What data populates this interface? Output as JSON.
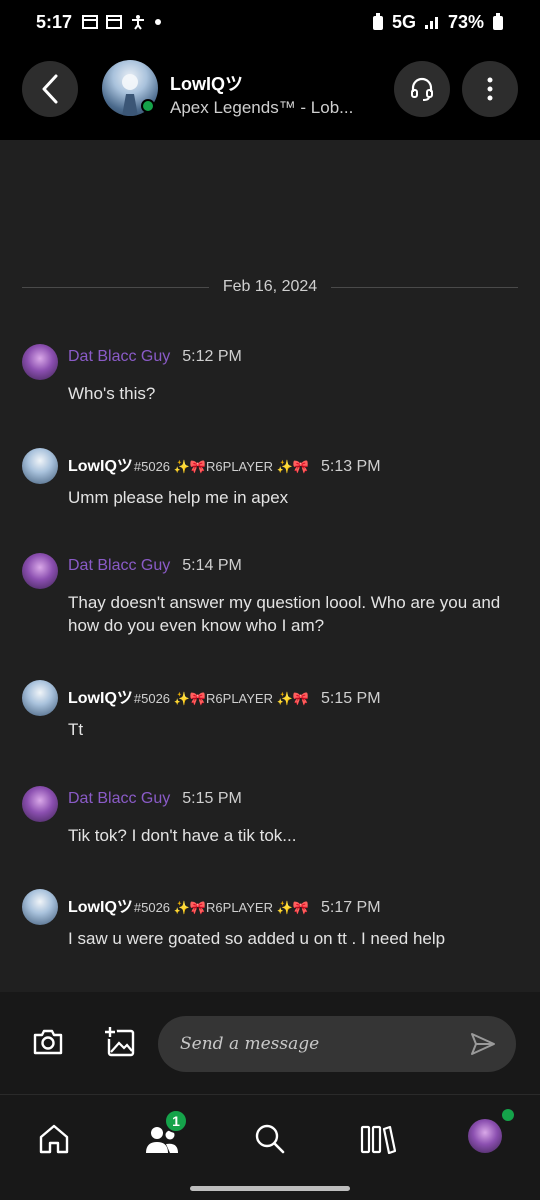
{
  "status_bar": {
    "time": "5:17",
    "network": "5G",
    "battery": "73%",
    "icons": [
      "calendar-icon",
      "calendar-icon",
      "accessibility-icon",
      "dot-icon",
      "battery-saver-icon",
      "signal-icon",
      "battery-icon"
    ]
  },
  "header": {
    "contact_name": "LowIQツ",
    "contact_status": "Apex Legends™ - Lob...",
    "presence": "online"
  },
  "chat": {
    "date_separator": "Feb 16, 2024",
    "messages": [
      {
        "sender": "Dat Blacc Guy",
        "tag": "",
        "time": "5:12 PM",
        "text": "Who's this?"
      },
      {
        "sender": "LowIQツ",
        "tag": "#5026 ✨🎀R6PLAYER ✨🎀",
        "time": "5:13 PM",
        "text": "Umm please help me in apex"
      },
      {
        "sender": "Dat Blacc Guy",
        "tag": "",
        "time": "5:14 PM",
        "text": "Thay doesn't answer my question loool. Who are you and how do you even know who I am?"
      },
      {
        "sender": "LowIQツ",
        "tag": "#5026 ✨🎀R6PLAYER ✨🎀",
        "time": "5:15 PM",
        "text": "Tt"
      },
      {
        "sender": "Dat Blacc Guy",
        "tag": "",
        "time": "5:15 PM",
        "text": "Tik tok? I don't have a tik tok..."
      },
      {
        "sender": "LowIQツ",
        "tag": "#5026 ✨🎀R6PLAYER ✨🎀",
        "time": "5:17 PM",
        "text": "I saw u were goated so added u on tt . I need help"
      }
    ]
  },
  "composer": {
    "placeholder": "Send a message"
  },
  "bottom_nav": {
    "friends_badge": "1"
  },
  "colors": {
    "accent_purple": "#8a5bc7",
    "online_green": "#15a34a",
    "background": "#202020"
  }
}
